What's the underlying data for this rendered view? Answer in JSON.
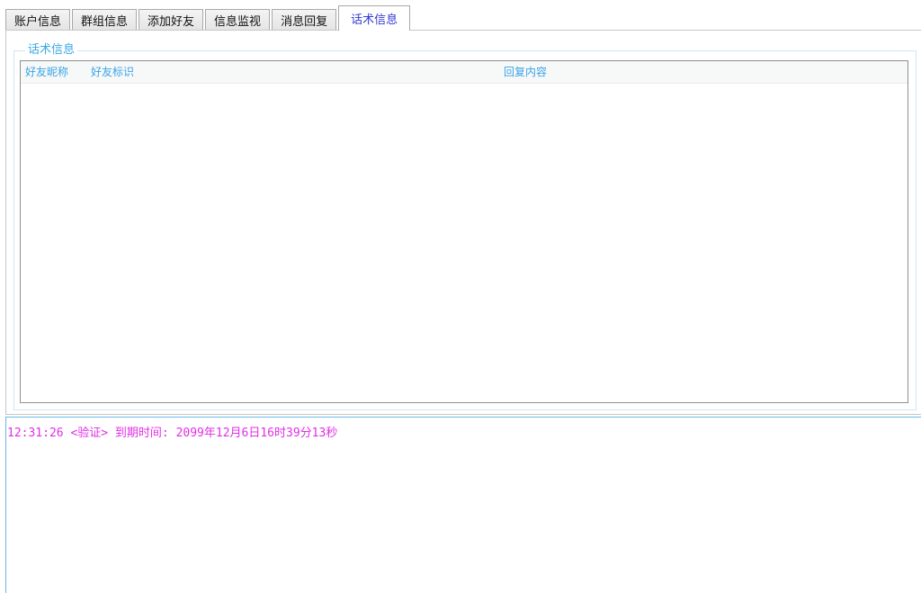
{
  "tabs": [
    {
      "label": "账户信息",
      "active": false
    },
    {
      "label": "群组信息",
      "active": false
    },
    {
      "label": "添加好友",
      "active": false
    },
    {
      "label": "信息监视",
      "active": false
    },
    {
      "label": "消息回复",
      "active": false
    },
    {
      "label": "话术信息",
      "active": true
    }
  ],
  "group": {
    "title": "话术信息",
    "columns": [
      "好友昵称",
      "好友标识",
      "回复内容"
    ],
    "rows": []
  },
  "log": {
    "lines": [
      "12:31:26 <验证> 到期时间: 2099年12月6日16时39分13秒"
    ]
  },
  "colors": {
    "active_tab_text": "#2f3bd0",
    "accent_blue": "#39a7e6",
    "log_text": "#e12fe6"
  }
}
